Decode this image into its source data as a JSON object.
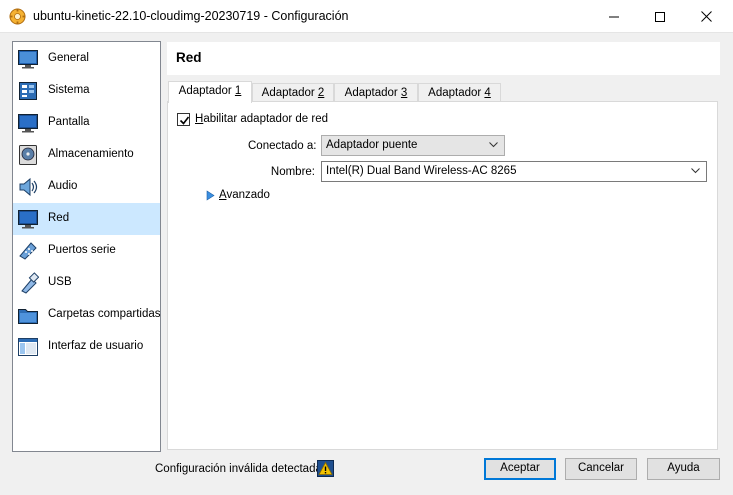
{
  "window": {
    "title": "ubuntu-kinetic-22.10-cloudimg-20230719 - Configuración"
  },
  "sidebar": {
    "items": [
      {
        "label": "General",
        "icon": "general-icon"
      },
      {
        "label": "Sistema",
        "icon": "system-icon"
      },
      {
        "label": "Pantalla",
        "icon": "display-icon"
      },
      {
        "label": "Almacenamiento",
        "icon": "storage-icon"
      },
      {
        "label": "Audio",
        "icon": "audio-icon"
      },
      {
        "label": "Red",
        "icon": "network-icon",
        "selected": true
      },
      {
        "label": "Puertos serie",
        "icon": "serial-ports-icon"
      },
      {
        "label": "USB",
        "icon": "usb-icon"
      },
      {
        "label": "Carpetas compartidas",
        "icon": "shared-folders-icon"
      },
      {
        "label": "Interfaz de usuario",
        "icon": "user-interface-icon"
      }
    ]
  },
  "section": {
    "title": "Red"
  },
  "tabs": [
    {
      "prefix": "Adaptador ",
      "accel": "1",
      "active": true
    },
    {
      "prefix": "Adaptador ",
      "accel": "2"
    },
    {
      "prefix": "Adaptador ",
      "accel": "3"
    },
    {
      "prefix": "Adaptador ",
      "accel": "4"
    }
  ],
  "adapter": {
    "enable_accel": "H",
    "enable_rest": "abilitar adaptador de red",
    "enabled": true,
    "attached_label": "Conectado a:",
    "attached_value": "Adaptador puente",
    "name_label": "Nombre:",
    "name_value": "Intel(R) Dual Band Wireless-AC 8265",
    "advanced_accel": "A",
    "advanced_rest": "vanzado"
  },
  "footer": {
    "status": "Configuración inválida detectada",
    "accept": "Aceptar",
    "cancel": "Cancelar",
    "help": "Ayuda"
  },
  "colors": {
    "selection": "#cce8ff",
    "accent": "#0078d7"
  }
}
